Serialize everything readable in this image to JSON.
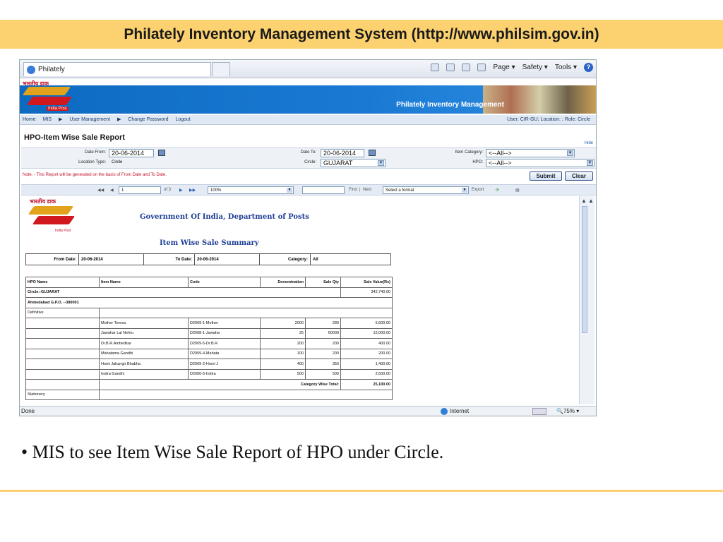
{
  "slide": {
    "title": "Philately Inventory Management System (http://www.philsim.gov.in)",
    "caption": "• MIS to see Item Wise Sale Report of HPO under Circle."
  },
  "browser": {
    "tab_title": "Philately",
    "tools": {
      "page": "Page",
      "safety": "Safety",
      "tools": "Tools"
    },
    "status": {
      "done": "Done",
      "zone": "Internet",
      "zoom": "75%"
    }
  },
  "app": {
    "logo_text": "भारतीय डाक",
    "logo_sub": "India Post",
    "title": "Philately Inventory Management",
    "menu": [
      "Home",
      "MIS",
      "▶",
      "User Management",
      "▶",
      "Change Password",
      "Logout"
    ],
    "user_info": "User: CIR-GU; Location: ; Role: Circle"
  },
  "report": {
    "title": "HPO-Item Wise Sale Report",
    "hide": "Hide",
    "filters": {
      "date_from_label": "Date From:",
      "date_from": "20-06-2014",
      "date_to_label": "Date To:",
      "date_to": "20-06-2014",
      "item_category_label": "Item Category:",
      "item_category": "<--All-->",
      "location_type_label": "Location Type:",
      "location_type": "Circle",
      "circle_label": "Circle:",
      "circle": "GUJARAT",
      "hpo_label": "HPO:",
      "hpo": "<--All-->"
    },
    "note": "Note: - This Report will be generated on the basis of From Date and To Date.",
    "submit": "Submit",
    "clear": "Clear",
    "viewer": {
      "page": "1",
      "of_pages": "of 3",
      "zoom": "100%",
      "find": "Find",
      "next": "Next",
      "format": "Select a format",
      "export": "Export"
    }
  },
  "doc": {
    "logo_text": "भारतीय डाक",
    "logo_sub": "India Post",
    "org": "Government Of India, Department of Posts",
    "summary_title": "Item Wise Sale Summary",
    "header": {
      "from_label": "From Date:",
      "from": "20-06-2014",
      "to_label": "To Date:",
      "to": "20-06-2014",
      "cat_label": "Category:",
      "cat": "All"
    },
    "columns": [
      "HPO Name",
      "Item Name",
      "Code",
      "Denomination",
      "Sale Qty",
      "Sale Value(Rs)"
    ],
    "circle_row": {
      "label": "Circle:-GUJARAT",
      "value": "342,740.00"
    },
    "hpo_row": "Ahmedabad G.P.O. --380001",
    "category_row": "Definitive",
    "rows": [
      {
        "item": "Mother Teresa",
        "code": "D2009-1-Mother",
        "denom": "2000",
        "qty": "280",
        "value": "5,600.00"
      },
      {
        "item": "Jawahar Lal Nehru",
        "code": "D2008-1-Jawaha",
        "denom": "25",
        "qty": "60000",
        "value": "15,000.00"
      },
      {
        "item": "Dr.B.R.Ambedkar",
        "code": "D2009-5-Dr.B.R",
        "denom": "200",
        "qty": "200",
        "value": "400.00"
      },
      {
        "item": "Mahatama Gandhi",
        "code": "D2009-4-Mahata",
        "denom": "100",
        "qty": "200",
        "value": "200.00"
      },
      {
        "item": "Homi Jahangir Bhabha",
        "code": "D2009-2-Homi J",
        "denom": "400",
        "qty": "350",
        "value": "1,400.00"
      },
      {
        "item": "Indira Gandhi",
        "code": "D2000-5-Indira",
        "denom": "500",
        "qty": "500",
        "value": "2,500.00"
      }
    ],
    "category_total": {
      "label": "Category Wise Total:",
      "value": "25,100.00"
    },
    "next_category": "Stationery"
  }
}
